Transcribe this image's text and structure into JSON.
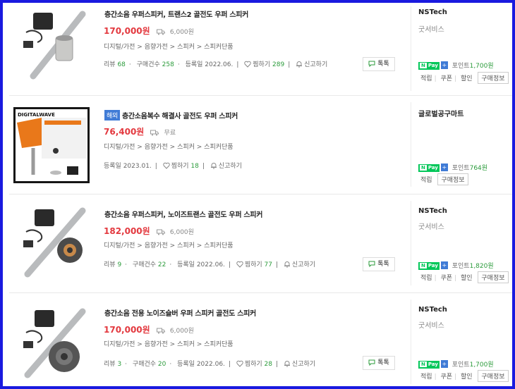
{
  "listings": [
    {
      "title": "층간소음 우퍼스피커, 트랜스2 골전도 우퍼 스피커",
      "price": "170,000원",
      "shipping": "6,000원",
      "badge": "",
      "category": "디지털/가전 > 음향가전 > 스피커 > 스피커단품",
      "review_label": "리뷰",
      "review_count": "68",
      "purchase_label": "구매건수",
      "purchase_count": "258",
      "registered": "등록일 2022.06.",
      "wish_label": "찜하기",
      "wish_count": "289",
      "report": "신고하기",
      "talk": "톡톡",
      "seller": "NSTech",
      "seller_sub": "굿서비스",
      "npay": "Pay",
      "point_label": "포인트",
      "point": "1,700원",
      "actions": [
        "적립",
        "쿠폰",
        "할인"
      ],
      "info": "구매정보"
    },
    {
      "title": "층간소음복수 해결사 골전도 우퍼 스피커",
      "price": "76,400원",
      "shipping": "무료",
      "badge": "해외",
      "category": "디지털/가전 > 음향가전 > 스피커 > 스피커단품",
      "registered": "등록일 2023.01.",
      "wish_label": "찜하기",
      "wish_count": "18",
      "report": "신고하기",
      "seller": "글로벌공구마트",
      "npay": "Pay",
      "point_label": "포인트",
      "point": "764원",
      "actions": [
        "적립"
      ],
      "info": "구매정보",
      "thumb_brand": "DIGITALWAVE"
    },
    {
      "title": "층간소음 우퍼스피커, 노이즈트랜스 골전도 우퍼 스피커",
      "price": "182,000원",
      "shipping": "6,000원",
      "category": "디지털/가전 > 음향가전 > 스피커 > 스피커단품",
      "review_label": "리뷰",
      "review_count": "9",
      "purchase_label": "구매건수",
      "purchase_count": "22",
      "registered": "등록일 2022.06.",
      "wish_label": "찜하기",
      "wish_count": "77",
      "report": "신고하기",
      "talk": "톡톡",
      "seller": "NSTech",
      "seller_sub": "굿서비스",
      "npay": "Pay",
      "point_label": "포인트",
      "point": "1,820원",
      "actions": [
        "적립",
        "쿠폰",
        "할인"
      ],
      "info": "구매정보"
    },
    {
      "title": "층간소음 전용 노이즈슬버 우퍼 스피커 골전도 스피커",
      "price": "170,000원",
      "shipping": "6,000원",
      "category": "디지털/가전 > 음향가전 > 스피커 > 스피커단품",
      "review_label": "리뷰",
      "review_count": "3",
      "purchase_label": "구매건수",
      "purchase_count": "20",
      "registered": "등록일 2022.06.",
      "wish_label": "찜하기",
      "wish_count": "28",
      "report": "신고하기",
      "talk": "톡톡",
      "seller": "NSTech",
      "seller_sub": "굿서비스",
      "npay": "Pay",
      "point_label": "포인트",
      "point": "1,700원",
      "actions": [
        "적립",
        "쿠폰",
        "할인"
      ],
      "info": "구매정보"
    }
  ],
  "colors": {
    "price": "#e3393f",
    "count": "#2b9b3b",
    "frame": "#1a1adf",
    "npay": "#03c75a"
  },
  "icons": [
    "truck-icon",
    "heart-icon",
    "bell-icon",
    "chat-icon",
    "npay-icon"
  ]
}
